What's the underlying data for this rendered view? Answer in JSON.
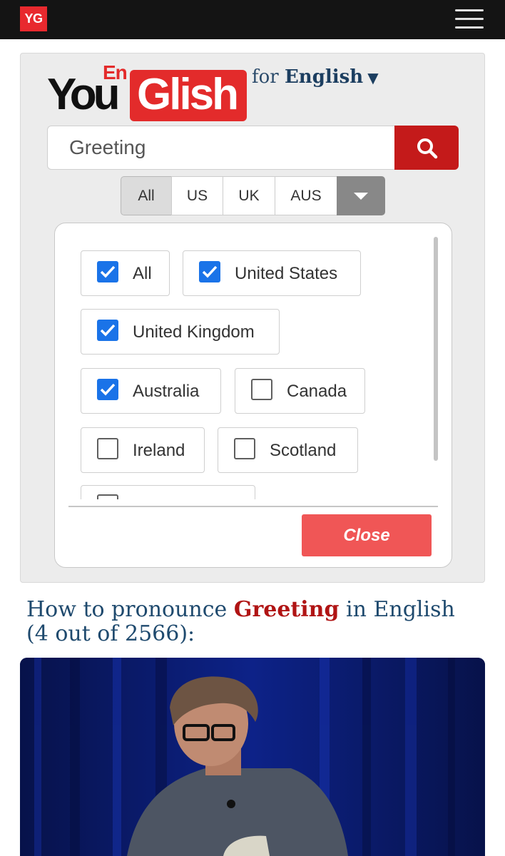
{
  "header": {
    "badge": "YG",
    "menu_icon": "hamburger-menu-icon"
  },
  "logo": {
    "en": "En",
    "you": "You",
    "glish": "Glish",
    "colors": {
      "red": "#e32b2b",
      "black": "#111111"
    }
  },
  "language_selector": {
    "prefix": "for",
    "language": "English",
    "arrow": "▼"
  },
  "search": {
    "value": "Greeting",
    "placeholder": "",
    "button_icon": "search-icon",
    "button_color": "#c41a1a"
  },
  "accent_tabs": [
    {
      "label": "All",
      "active": true
    },
    {
      "label": "US",
      "active": false
    },
    {
      "label": "UK",
      "active": false
    },
    {
      "label": "AUS",
      "active": false
    }
  ],
  "accent_dropdown": {
    "options": [
      {
        "label": "All",
        "checked": true
      },
      {
        "label": "United States",
        "checked": true
      },
      {
        "label": "United Kingdom",
        "checked": true
      },
      {
        "label": "Australia",
        "checked": true
      },
      {
        "label": "Canada",
        "checked": false
      },
      {
        "label": "Ireland",
        "checked": false
      },
      {
        "label": "Scotland",
        "checked": false
      }
    ],
    "close_label": "Close",
    "check_color": "#1a73e8"
  },
  "result": {
    "prefix": "How to pronounce",
    "word": "Greeting",
    "suffix": "in English (4 out of 2566):"
  }
}
